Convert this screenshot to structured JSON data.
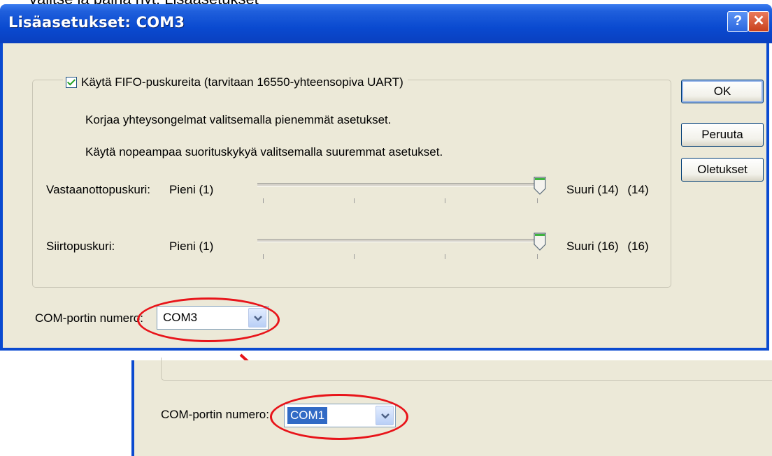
{
  "caption_cut": "Valitse ja paina nyt: Lisäasetukset",
  "window": {
    "title": "Lisäasetukset: COM3",
    "help_glyph": "?",
    "close_glyph": "✕"
  },
  "fifo": {
    "checked": true,
    "label": "Käytä FIFO-puskureita (tarvitaan 16550-yhteensopiva UART)"
  },
  "hints": {
    "line1": "Korjaa yhteysongelmat valitsemalla pienemmät asetukset.",
    "line2": "Käytä nopeampaa suorituskykyä valitsemalla suuremmat asetukset."
  },
  "receive_buffer": {
    "label": "Vastaanottopuskuri:",
    "min": "Pieni (1)",
    "max": "Suuri (14)",
    "current": "(14)",
    "value_fraction": 1.0
  },
  "transmit_buffer": {
    "label": "Siirtopuskuri:",
    "min": "Pieni (1)",
    "max": "Suuri (16)",
    "current": "(16)",
    "value_fraction": 1.0
  },
  "buttons": {
    "ok": "OK",
    "cancel": "Peruuta",
    "defaults": "Oletukset"
  },
  "com_port": {
    "label": "COM-portin numero:",
    "value": "COM3"
  },
  "com_port_after": {
    "label": "COM-portin numero:",
    "value": "COM1"
  },
  "colors": {
    "highlight_ellipse": "#e8141a",
    "arrow": "#e8141a",
    "selection": "#316ac5"
  }
}
